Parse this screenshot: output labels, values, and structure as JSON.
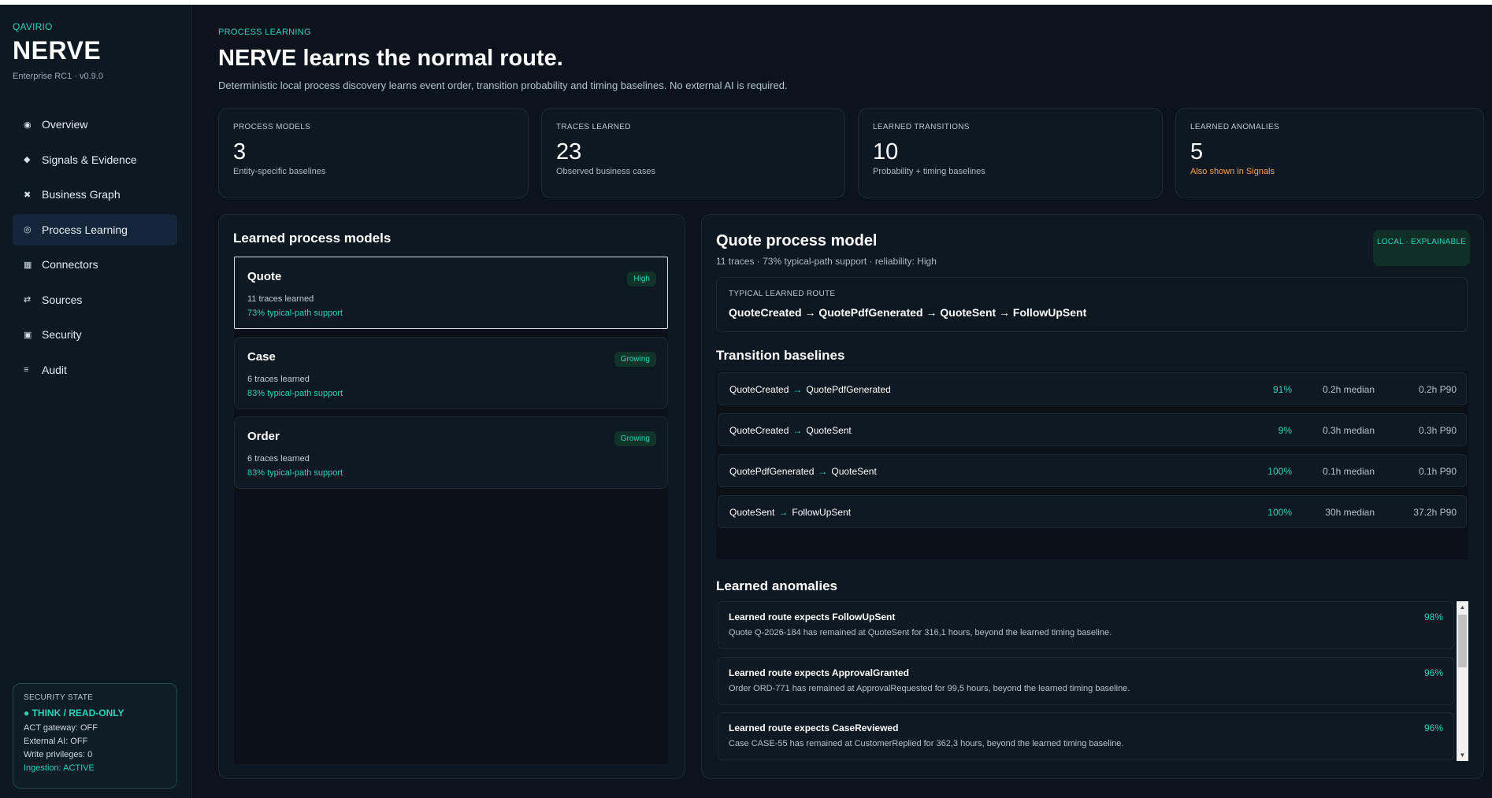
{
  "brand": {
    "kicker": "QAVIRIO",
    "title": "NERVE",
    "version": "Enterprise RC1 · v0.9.0"
  },
  "nav": {
    "items": [
      {
        "icon": "◉",
        "label": "Overview"
      },
      {
        "icon": "◆",
        "label": "Signals & Evidence"
      },
      {
        "icon": "✖",
        "label": "Business Graph"
      },
      {
        "icon": "◎",
        "label": "Process Learning"
      },
      {
        "icon": "▦",
        "label": "Connectors"
      },
      {
        "icon": "⇄",
        "label": "Sources"
      },
      {
        "icon": "▣",
        "label": "Security"
      },
      {
        "icon": "≡",
        "label": "Audit"
      }
    ],
    "active": "Process Learning"
  },
  "security": {
    "kicker": "SECURITY STATE",
    "state": "● THINK / READ-ONLY",
    "act_gateway": "ACT gateway: OFF",
    "external_ai": "External AI: OFF",
    "write_privileges": "Write privileges: 0",
    "ingestion": "Ingestion: ACTIVE"
  },
  "header": {
    "kicker": "PROCESS LEARNING",
    "title": "NERVE learns the normal route.",
    "subtitle": "Deterministic local process discovery learns event order, transition probability and timing baselines. No external AI is required."
  },
  "stats": [
    {
      "label": "PROCESS MODELS",
      "value": "3",
      "note": "Entity-specific baselines"
    },
    {
      "label": "TRACES LEARNED",
      "value": "23",
      "note": "Observed business cases"
    },
    {
      "label": "LEARNED TRANSITIONS",
      "value": "10",
      "note": "Probability + timing baselines"
    },
    {
      "label": "LEARNED ANOMALIES",
      "value": "5",
      "note": "Also shown in Signals"
    }
  ],
  "models": {
    "title": "Learned process models",
    "items": [
      {
        "name": "Quote",
        "badge": "High",
        "traces": "11 traces learned",
        "support": "73% typical-path support"
      },
      {
        "name": "Case",
        "badge": "Growing",
        "traces": "6 traces learned",
        "support": "83% typical-path support"
      },
      {
        "name": "Order",
        "badge": "Growing",
        "traces": "6 traces learned",
        "support": "83% typical-path support"
      }
    ]
  },
  "detail": {
    "title": "Quote process model",
    "subtitle": "11 traces · 73% typical-path support · reliability: High",
    "badge": "LOCAL · EXPLAINABLE",
    "route_kicker": "TYPICAL LEARNED ROUTE",
    "route": "QuoteCreated → QuotePdfGenerated → QuoteSent → FollowUpSent",
    "transitions_title": "Transition baselines",
    "transitions": [
      {
        "from": "QuoteCreated",
        "arrow": "→",
        "to": "QuotePdfGenerated",
        "pct": "91%",
        "median": "0.2h median",
        "p90": "0.2h P90"
      },
      {
        "from": "QuoteCreated",
        "arrow": "→",
        "to": "QuoteSent",
        "pct": "9%",
        "median": "0.3h median",
        "p90": "0.3h P90"
      },
      {
        "from": "QuotePdfGenerated",
        "arrow": "→",
        "to": "QuoteSent",
        "pct": "100%",
        "median": "0.1h median",
        "p90": "0.1h P90"
      },
      {
        "from": "QuoteSent",
        "arrow": "→",
        "to": "FollowUpSent",
        "pct": "100%",
        "median": "30h median",
        "p90": "37.2h P90"
      }
    ],
    "anomalies_title": "Learned anomalies",
    "anomalies": [
      {
        "title": "Learned route expects FollowUpSent",
        "pct": "98%",
        "desc": "Quote Q-2026-184 has remained at QuoteSent for 316,1 hours, beyond the learned timing baseline."
      },
      {
        "title": "Learned route expects ApprovalGranted",
        "pct": "96%",
        "desc": "Order ORD-771 has remained at ApprovalRequested for 99,5 hours, beyond the learned timing baseline."
      },
      {
        "title": "Learned route expects CaseReviewed",
        "pct": "96%",
        "desc": "Case CASE-55 has remained at CustomerReplied for 362,3 hours, beyond the learned timing baseline."
      }
    ]
  },
  "colors": {
    "accent": "#2fd1b8",
    "warning": "#f5a35b",
    "background": "#0b131c"
  }
}
